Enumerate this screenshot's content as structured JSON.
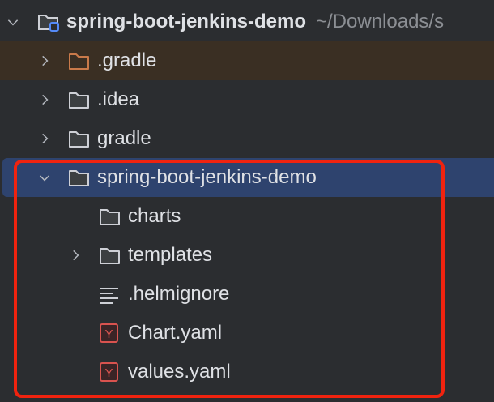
{
  "tree": {
    "root": {
      "label": "spring-boot-jenkins-demo",
      "path": "~/Downloads/s",
      "expanded": true,
      "icon": "module-folder-icon"
    },
    "items": [
      {
        "label": ".gradle",
        "level": 1,
        "expandable": true,
        "expanded": false,
        "icon": "excluded-folder-icon",
        "state": "excluded"
      },
      {
        "label": ".idea",
        "level": 1,
        "expandable": true,
        "expanded": false,
        "icon": "folder-icon"
      },
      {
        "label": "gradle",
        "level": 1,
        "expandable": true,
        "expanded": false,
        "icon": "folder-icon"
      },
      {
        "label": "spring-boot-jenkins-demo",
        "level": 1,
        "expandable": true,
        "expanded": true,
        "icon": "folder-icon",
        "state": "selected"
      },
      {
        "label": "charts",
        "level": 2,
        "expandable": false,
        "icon": "folder-icon"
      },
      {
        "label": "templates",
        "level": 2,
        "expandable": true,
        "expanded": false,
        "icon": "folder-icon"
      },
      {
        "label": ".helmignore",
        "level": 2,
        "expandable": false,
        "icon": "text-file-icon"
      },
      {
        "label": "Chart.yaml",
        "level": 2,
        "expandable": false,
        "icon": "yaml-file-icon"
      },
      {
        "label": "values.yaml",
        "level": 2,
        "expandable": false,
        "icon": "yaml-file-icon"
      }
    ]
  },
  "colors": {
    "background": "#2b2d30",
    "selection": "#2e436e",
    "excluded": "#3a2f23",
    "highlight_box": "#f0230f",
    "yaml": "#d9534f",
    "excluded_folder": "#c97a4a"
  }
}
